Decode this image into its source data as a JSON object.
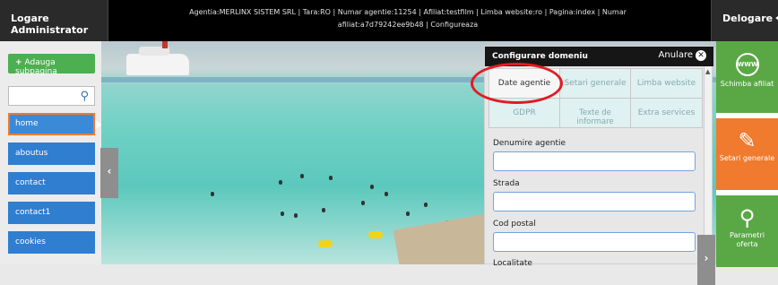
{
  "topbar": {
    "admin_label": "Logare Administrator",
    "info_line1": "Agentia:MERLINX SISTEM SRL | Tara:RO | Numar agentie:11254 | Afiliat:testfilm | Limba website:ro | Pagina:index | Numar",
    "info_line2": "afiliat:a7d79242ee9b48 | Configureaza",
    "logout_label": "Delogare"
  },
  "sidebar": {
    "add_page_label": "Adauga subpagina",
    "search_placeholder": "",
    "items": [
      {
        "label": "home"
      },
      {
        "label": "aboutus"
      },
      {
        "label": "contact"
      },
      {
        "label": "contact1"
      },
      {
        "label": "cookies"
      }
    ]
  },
  "panel": {
    "title": "Configurare domeniu",
    "cancel_label": "Anulare",
    "tabs": [
      {
        "label": "Date agentie"
      },
      {
        "label": "Setari generale"
      },
      {
        "label": "Limba website"
      },
      {
        "label": "GDPR"
      },
      {
        "label": "Texte de informare"
      },
      {
        "label": "Extra services"
      }
    ],
    "fields": [
      {
        "label": "Denumire agentie",
        "value": ""
      },
      {
        "label": "Strada",
        "value": ""
      },
      {
        "label": "Cod postal",
        "value": ""
      },
      {
        "label": "Localitate",
        "value": ""
      }
    ]
  },
  "rightbar": {
    "buttons": [
      {
        "label": "Schimba afiliat",
        "icon": "globe-icon",
        "globe_text": "WWW",
        "color": "#5aa845"
      },
      {
        "label": "Setari generale",
        "icon": "edit-icon",
        "color": "#f07a2d"
      },
      {
        "label": "Parametri oferta",
        "icon": "search-icon",
        "color": "#5aa845"
      }
    ]
  },
  "colors": {
    "accent_blue": "#2f7ed0",
    "accent_green": "#5aa845",
    "accent_orange": "#f07a2d",
    "highlight_red": "#e31b23"
  }
}
